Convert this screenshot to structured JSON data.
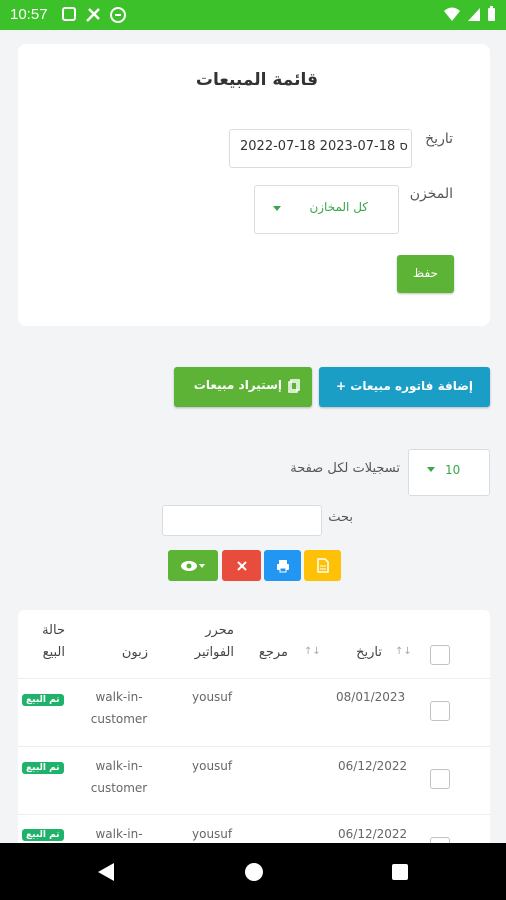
{
  "status_bar": {
    "time": "10:57",
    "icons": [
      "notification-a-icon",
      "tools-icon",
      "sync-icon"
    ],
    "right_icons": [
      "wifi-icon",
      "signal-icon",
      "battery-icon"
    ]
  },
  "filter_card": {
    "title": "قائمة المبيعات",
    "date_label": "تاريخ",
    "date_value": "2022-07-18 2023-07-18 ס",
    "warehouse_label": "المخزن",
    "warehouse_value": "كل المخازن",
    "save_label": "حفظ"
  },
  "actions": {
    "add_invoice_label": "إضافة فاتوره مبيعات +",
    "import_label": "إستيراد مبيعات"
  },
  "table_controls": {
    "per_page_value": "10",
    "per_page_label": "تسجيلات لكل صفحة",
    "search_label": "بحث",
    "search_value": ""
  },
  "table": {
    "headers": {
      "date": "تاريخ",
      "reference": "مرجع",
      "invoice_editor": "محرر الفواتير",
      "customer": "زبون",
      "sale_status": "حالة البيع"
    },
    "rows": [
      {
        "date": "08/01/2023",
        "reference": "",
        "editor": "yousuf",
        "customer": "walk-in-customer",
        "status": "تم البيع"
      },
      {
        "date": "06/12/2022",
        "reference": "",
        "editor": "yousuf",
        "customer": "walk-in-customer",
        "status": "تم البيع"
      },
      {
        "date": "06/12/2022",
        "reference": "",
        "editor": "yousuf",
        "customer": "walk-in-",
        "status": "تم البيع"
      }
    ]
  },
  "colors": {
    "status_bar": "#3cc12a",
    "primary_green": "#5cb335",
    "teal": "#1b9ec6",
    "danger": "#e74c3c",
    "info": "#2196f3",
    "warning": "#ffc107",
    "badge": "#1fb26b"
  }
}
